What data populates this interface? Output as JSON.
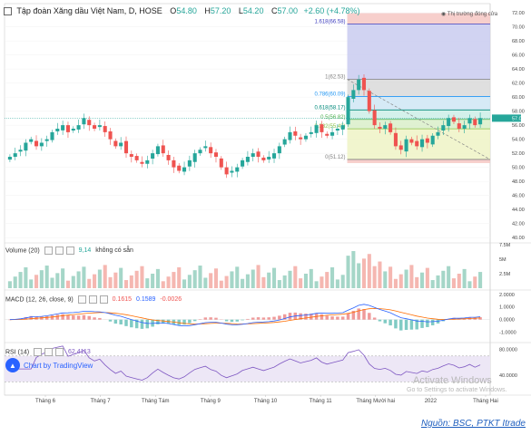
{
  "header": {
    "title": "Tập đoàn Xăng dầu Việt Nam, D, HOSE",
    "open_label": "O",
    "open": "54.80",
    "high_label": "H",
    "high": "57.20",
    "low_label": "L",
    "low": "54.20",
    "close_label": "C",
    "close": "57.00",
    "change": "+2.60 (+4.78%)"
  },
  "annotation_top": "Thị trường đóng cửa",
  "volume_panel": {
    "label": "Volume (20)",
    "value": "9,14",
    "note": "không có sẵn"
  },
  "macd_panel": {
    "label": "MACD (12, 26, close, 9)",
    "v1": "0.1615",
    "v2": "0.1589",
    "v3": "-0.0026"
  },
  "rsi_panel": {
    "label": "RSI (14)",
    "value": "62.4113"
  },
  "tradingview_badge": "Chart by TradingView",
  "watermark": {
    "line1": "Activate Windows",
    "line2": "Go to Settings to activate Windows."
  },
  "source_caption": "Nguồn: BSC, PTKT Itrade",
  "colors": {
    "up": "#26a69a",
    "down": "#ef5350",
    "macd": "#2962ff",
    "signal": "#ff6d00",
    "rsi": "#7e57c2"
  },
  "chart_data": {
    "type": "candlestick",
    "price_axis": {
      "ticks": [
        40,
        42,
        44,
        46,
        48,
        50,
        52,
        54,
        56,
        58,
        60,
        62,
        64,
        66,
        68,
        70,
        72
      ],
      "ylim": [
        39.5,
        71.5
      ]
    },
    "last_price_label": "57.00",
    "x_ticks": [
      "Tháng 6",
      "Tháng 7",
      "Tháng Tám",
      "Tháng 9",
      "Tháng 10",
      "Tháng 11",
      "Tháng Mười hai",
      "2022",
      "Tháng Hai"
    ],
    "close_series": [
      51.5,
      52,
      52.5,
      53.5,
      54,
      53,
      53.5,
      54,
      55,
      55.5,
      56,
      55,
      55.5,
      56,
      57,
      56,
      55.5,
      56,
      55,
      54,
      53,
      53.5,
      52,
      51.5,
      51,
      50.5,
      51,
      52,
      53,
      52,
      51,
      50,
      49.5,
      50,
      51,
      52,
      52.5,
      53,
      52,
      51.5,
      50,
      49,
      49.5,
      50,
      51,
      51.5,
      52,
      51.5,
      51,
      51.5,
      52,
      53,
      54,
      55,
      54.5,
      54,
      54.5,
      55,
      56,
      55,
      54.5,
      55,
      55.5,
      56,
      60,
      61,
      62.5,
      61,
      58,
      56,
      55.5,
      56,
      55,
      53,
      52.5,
      54,
      53.5,
      53,
      54,
      53.5,
      54.5,
      55,
      56,
      57,
      56.5,
      55.5,
      56,
      57,
      56,
      57
    ],
    "volume_axis": {
      "ticks": [
        "7.5M",
        "5M",
        "2.5M"
      ],
      "ylim": [
        0,
        7.5
      ]
    },
    "macd_axis": {
      "ticks": [
        "2.0000",
        "1.0000",
        "0.0000",
        "-1.0000"
      ],
      "ylim": [
        -1.6,
        2.2
      ]
    },
    "rsi_axis": {
      "ticks": [
        "80.0000",
        "40.0000"
      ],
      "ylim": [
        22,
        88
      ]
    },
    "fibonacci": {
      "levels": [
        {
          "label": "1.618(66.58)",
          "value": 70.4,
          "color": "#3f3fbf"
        },
        {
          "label": "1(62.53)",
          "value": 62.53,
          "color": "#808080"
        },
        {
          "label": "0.786(60.09)",
          "value": 60.09,
          "color": "#2196f3"
        },
        {
          "label": "0.618(58.17)",
          "value": 58.17,
          "color": "#00897b"
        },
        {
          "label": "0.5(56.82)",
          "value": 56.82,
          "color": "#4caf50"
        },
        {
          "label": "0.382(55.48)",
          "value": 55.48,
          "color": "#8bc34a"
        },
        {
          "label": "0(51.12)",
          "value": 51.12,
          "color": "#808080"
        }
      ]
    }
  }
}
